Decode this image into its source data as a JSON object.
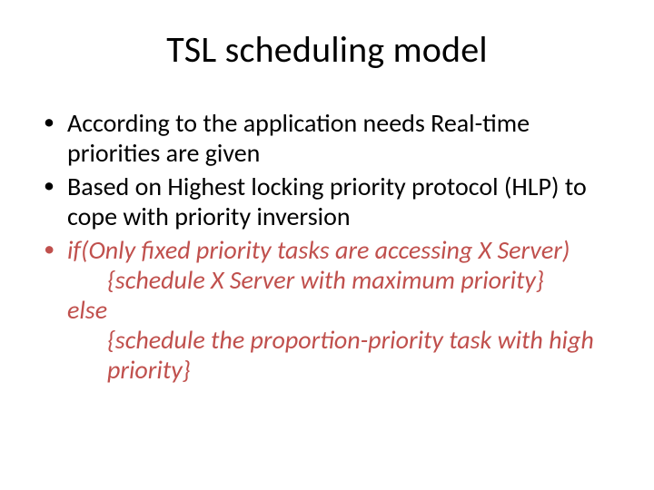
{
  "title": "TSL scheduling model",
  "bullets": {
    "b1": "According to the application needs Real-time priorities are given",
    "b2": "Based on Highest locking priority protocol (HLP) to cope with priority inversion",
    "b3": {
      "l1": "if(Only fixed priority tasks are accessing X Server)",
      "l2": "{schedule X Server with maximum priority}",
      "l3": "else",
      "l4": "{schedule the proportion-priority task with high priority}"
    }
  }
}
